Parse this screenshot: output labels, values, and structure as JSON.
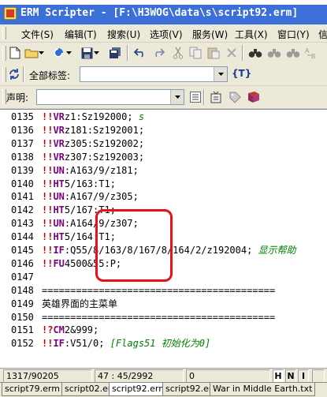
{
  "window": {
    "title": "ERM Scripter - [F:\\H3WOG\\data\\s\\script92.erm]",
    "app_icon": "erm-scripter-icon"
  },
  "menu": [
    "文件(S)",
    "编辑(T)",
    "搜索(U)",
    "选项(V)",
    "服务(W)",
    "工具(X)",
    "窗口(Y)",
    "信"
  ],
  "toolbar2": {
    "label": "全部标签:",
    "value": "",
    "t_button": "{T}"
  },
  "toolbar3": {
    "label": "声明:",
    "value": ""
  },
  "editor": {
    "lines": [
      {
        "num": "0135",
        "code": "!!VRz1:Sz192000;",
        "comment": "s"
      },
      {
        "num": "0136",
        "code": "!!VRz181:Sz192001;",
        "comment": ""
      },
      {
        "num": "0137",
        "code": "!!VRz305:Sz192002;",
        "comment": ""
      },
      {
        "num": "0138",
        "code": "!!VRz307:Sz192003;",
        "comment": ""
      },
      {
        "num": "0139",
        "code": "!!UN:A163/9/z181;",
        "comment": ""
      },
      {
        "num": "0140",
        "code": "!!HT5/163:T1;",
        "comment": ""
      },
      {
        "num": "0141",
        "code": "!!UN:A167/9/z305;",
        "comment": ""
      },
      {
        "num": "0142",
        "code": "!!HT5/167:T1;",
        "comment": ""
      },
      {
        "num": "0143",
        "code": "!!UN:A164/9/z307;",
        "comment": ""
      },
      {
        "num": "0144",
        "code": "!!HT5/164:T1;",
        "comment": ""
      },
      {
        "num": "0145",
        "code": "!!IF:Q55/8/163/8/167/8/164/2/z192004;",
        "comment": "显示帮助"
      },
      {
        "num": "0146",
        "code": "!!FU4500&55:P;",
        "comment": ""
      },
      {
        "num": "0147",
        "code": "",
        "comment": ""
      },
      {
        "num": "0148",
        "code": "=========================================",
        "comment": ""
      },
      {
        "num": "0149",
        "code": "英雄界面的主菜单",
        "comment": ""
      },
      {
        "num": "0150",
        "code": "=========================================",
        "comment": ""
      },
      {
        "num": "0151",
        "code": "!?CM2&999;",
        "comment": ""
      },
      {
        "num": "0152",
        "code": "!!IF:V51/0;",
        "comment": "[Flags51 初始化为0]"
      }
    ]
  },
  "status": {
    "position": "1317/90205",
    "cursor": "47 : 45/2992",
    "value": "0",
    "mode_h": "H",
    "mode_n": "N",
    "mode_i": "I"
  },
  "tabs": [
    "script79.erm",
    "script02.ert",
    "script92.erm",
    "script92.ert",
    "War in Middle Earth.txt"
  ],
  "active_tab": 2,
  "colors": {
    "titlebar": "#3c6fd8",
    "keyword": "#800080",
    "comment": "#008000",
    "highlight": "#e8101a"
  }
}
